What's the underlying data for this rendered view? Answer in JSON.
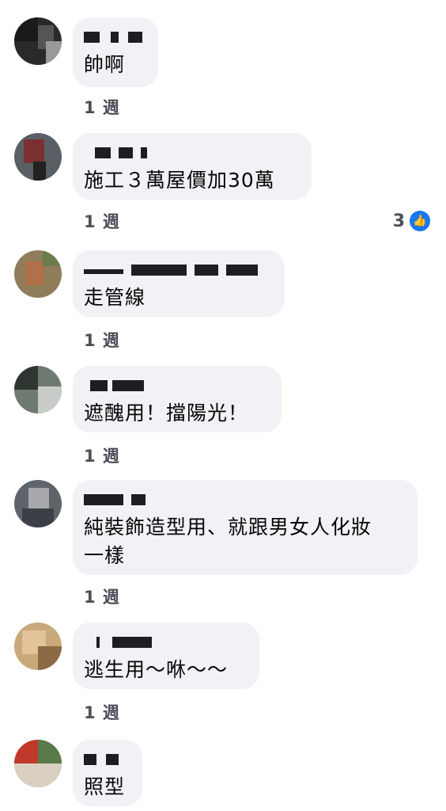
{
  "comments": [
    {
      "text": "帥啊",
      "time": "1 週"
    },
    {
      "text": "施工３萬屋價加30萬",
      "time": "1 週",
      "reaction_count": "3",
      "reaction_icon": "like-icon"
    },
    {
      "text": "走管線",
      "time": "1 週"
    },
    {
      "text": "遮醜用！擋陽光！",
      "time": "1 週"
    },
    {
      "text": "純裝飾造型用、就跟男女人化妝\n一樣",
      "time": "1 週"
    },
    {
      "text": "逃生用～咻～～",
      "time": "1 週"
    },
    {
      "text": "照型"
    }
  ],
  "colors": {
    "bubble": "#f0f2f5",
    "like": "#1877f2",
    "time": "#4b4f56"
  }
}
